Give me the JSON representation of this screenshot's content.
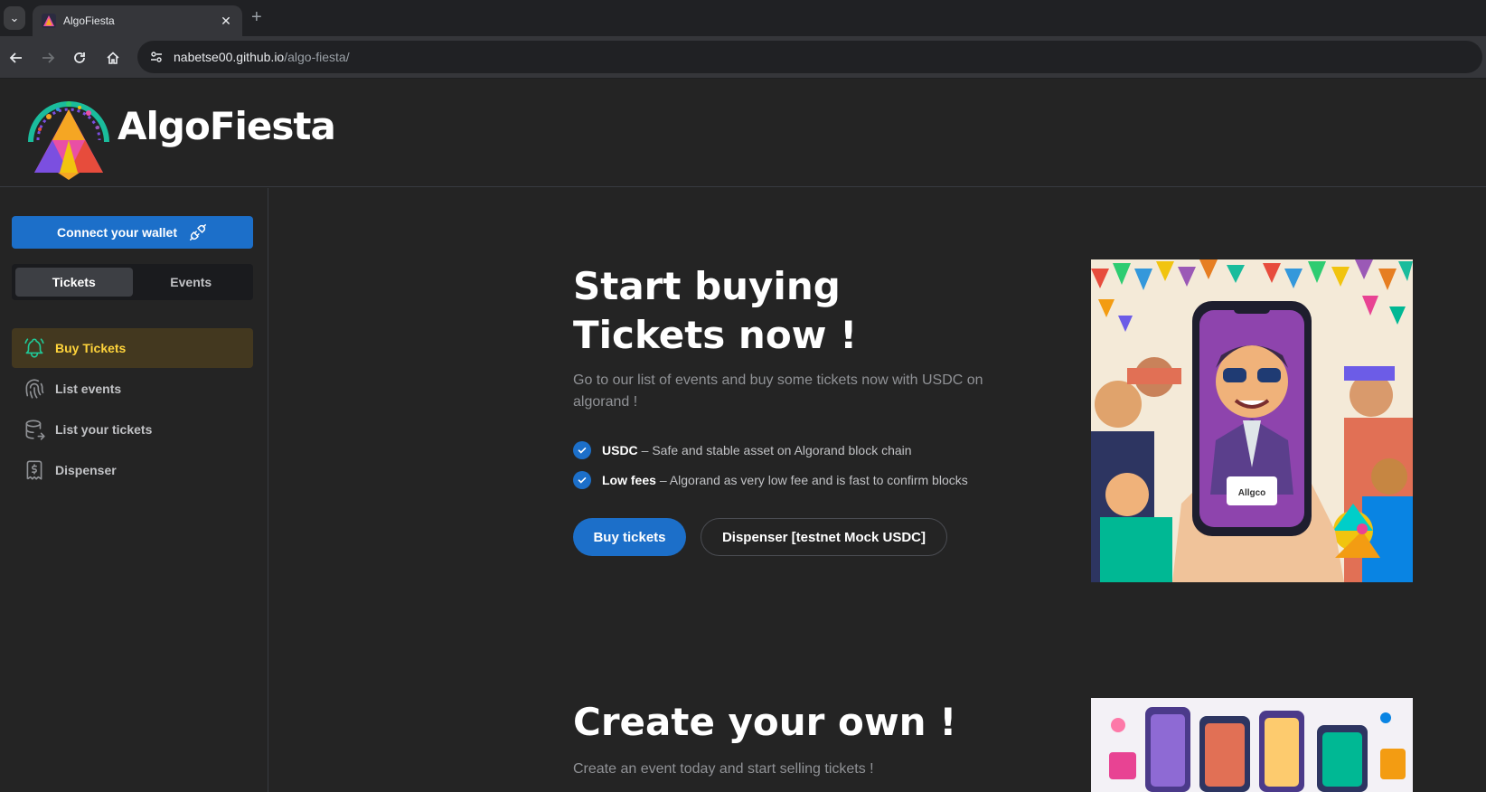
{
  "browser": {
    "tab_title": "AlgoFiesta",
    "url_host": "nabetse00.github.io",
    "url_path": "/algo-fiesta/"
  },
  "header": {
    "brand": "AlgoFiesta"
  },
  "sidebar": {
    "wallet_button": "Connect your wallet",
    "segments": [
      "Tickets",
      "Events"
    ],
    "active_segment": "Tickets",
    "items": [
      {
        "label": "Buy Tickets",
        "icon": "bell-icon",
        "active": true
      },
      {
        "label": "List events",
        "icon": "fingerprint-icon",
        "active": false
      },
      {
        "label": "List your tickets",
        "icon": "database-export-icon",
        "active": false
      },
      {
        "label": "Dispenser",
        "icon": "receipt-dollar-icon",
        "active": false
      }
    ]
  },
  "hero": {
    "title": "Start buying Tickets now !",
    "description": "Go to our list of events and buy some tickets now with USDC on algorand !",
    "features": [
      {
        "title": "USDC",
        "text": "– Safe and stable asset on Algorand block chain"
      },
      {
        "title": "Low fees",
        "text": "– Algorand as very low fee and is fast to confirm blocks"
      }
    ],
    "primary_button": "Buy tickets",
    "secondary_button": "Dispenser [testnet Mock USDC]",
    "phone_label": "Allgco"
  },
  "section2": {
    "title": "Create your own !",
    "description": "Create an event today and start selling tickets !"
  },
  "colors": {
    "accent": "#1c6fc9",
    "active_nav_bg": "#43381f",
    "active_nav_text": "#ffd43b",
    "background": "#242424"
  }
}
